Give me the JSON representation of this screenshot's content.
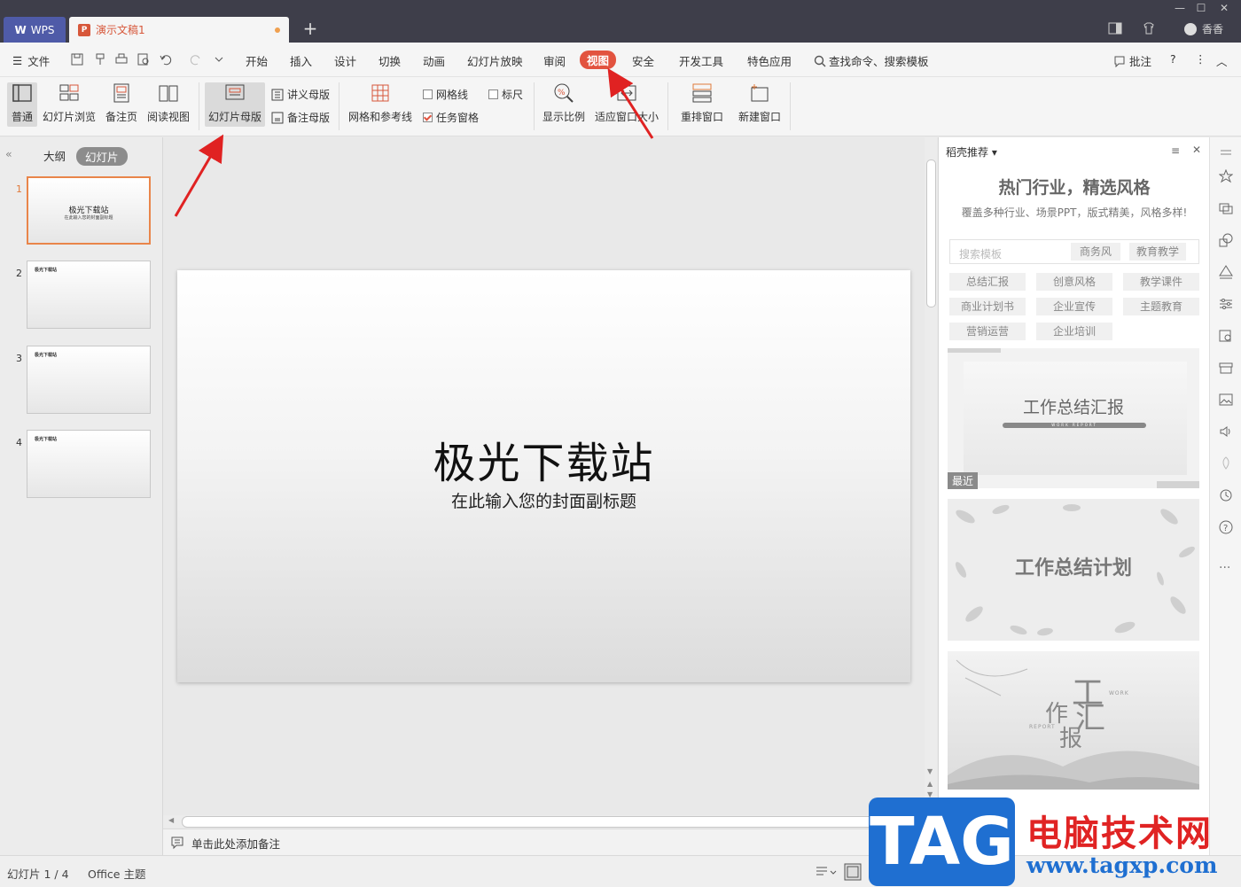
{
  "titlebar": {
    "app_tab": "WPS",
    "doc_tab": "演示文稿1",
    "user_name": "香香"
  },
  "menu": {
    "file": "文件",
    "items": [
      "开始",
      "插入",
      "设计",
      "切换",
      "动画",
      "幻灯片放映",
      "审阅",
      "视图",
      "安全",
      "开发工具",
      "特色应用"
    ],
    "active": "视图",
    "search": "查找命令、搜索模板",
    "comment": "批注"
  },
  "ribbon": {
    "normal": "普通",
    "slide_sorter": "幻灯片浏览",
    "notes_page": "备注页",
    "reading_view": "阅读视图",
    "slide_master": "幻灯片母版",
    "handout_master": "讲义母版",
    "notes_master": "备注母版",
    "grid_guides": "网格和参考线",
    "gridlines": "网格线",
    "ruler": "标尺",
    "task_pane": "任务窗格",
    "zoom": "显示比例",
    "fit_window": "适应窗口大小",
    "arrange": "重排窗口",
    "new_window": "新建窗口"
  },
  "left_panel": {
    "tab_outline": "大纲",
    "tab_slides": "幻灯片",
    "thumbnails": [
      {
        "num": "1",
        "title": "极光下载站",
        "subtitle": "在此输入您的封面副标题"
      },
      {
        "num": "2",
        "header": "极光下载站"
      },
      {
        "num": "3",
        "header": "极光下载站"
      },
      {
        "num": "4",
        "header": "极光下载站"
      }
    ]
  },
  "slide": {
    "title": "极光下载站",
    "subtitle": "在此输入您的封面副标题"
  },
  "notes": {
    "placeholder": "单击此处添加备注"
  },
  "right_panel": {
    "header": "稻壳推荐",
    "headline": "热门行业，精选风格",
    "subline": "覆盖多种行业、场景PPT，版式精美，风格多样!",
    "search_placeholder": "搜索模板",
    "search_chips": [
      "商务风",
      "教育教学"
    ],
    "categories": [
      "总结汇报",
      "创意风格",
      "教学课件",
      "商业计划书",
      "企业宣传",
      "主题教育",
      "营销运营",
      "企业培训"
    ],
    "templates": [
      {
        "title": "工作总结汇报",
        "tag": "最近",
        "caption": "WORK REPORT"
      },
      {
        "title": "工作总结计划"
      },
      {
        "title": "工作汇报",
        "chars": [
          "工",
          "作",
          "汇",
          "报"
        ],
        "en1": "WORK",
        "en2": "REPORT"
      }
    ]
  },
  "statusbar": {
    "slide_count": "幻灯片 1 / 4",
    "theme": "Office 主题"
  },
  "watermark": {
    "tag": "TAG",
    "site_name": "电脑技术网",
    "url": "www.tagxp.com"
  },
  "colors": {
    "accent": "#e2533f",
    "titlebar": "#3e3e4a",
    "wps_tab": "#4f5ba8"
  }
}
